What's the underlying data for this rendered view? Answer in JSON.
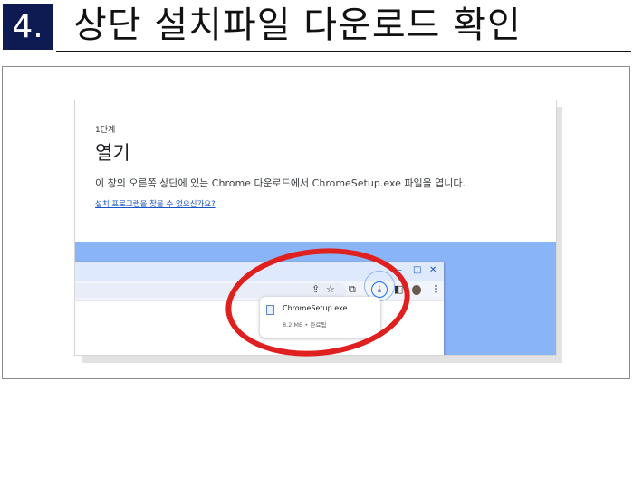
{
  "header": {
    "step_number": "4.",
    "title": "상단 설치파일 다운로드 확인"
  },
  "card": {
    "step_label": "1단계",
    "heading": "열기",
    "description": "이 창의 오른쪽 상단에 있는 Chrome 다운로드에서 ChromeSetup.exe 파일을 엽니다.",
    "help_link": "설치 프로그램을 찾을 수 없으신가요?"
  },
  "browser": {
    "window_controls": {
      "minimize": "–",
      "maximize": "□",
      "close": "✕"
    },
    "toolbar_icons": [
      "share-icon",
      "star-icon",
      "extension-icon",
      "download-icon",
      "side-panel-icon",
      "profile-avatar",
      "menu-icon"
    ],
    "glyphs": {
      "share": "⇪",
      "star": "☆",
      "extension": "⧉",
      "download": "⤓",
      "side_panel": "◧",
      "menu": "⋮"
    }
  },
  "download_popup": {
    "file_name": "ChromeSetup.exe",
    "file_meta": "8.2 MB • 완료됨"
  },
  "colors": {
    "badge_bg": "#0d1b52",
    "panel_blue": "#8ab4f8",
    "highlight_red": "#e0201f",
    "link_blue": "#1a55c6"
  }
}
